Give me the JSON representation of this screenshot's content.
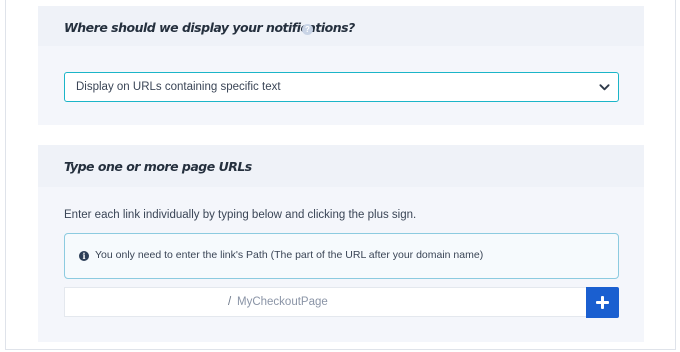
{
  "display_section": {
    "question": "Where should we display your notifications?",
    "help_icon": "?",
    "select": {
      "value": "Display on URLs containing specific text"
    }
  },
  "urls_section": {
    "title": "Type one or more page URLs",
    "instructions": "Enter each link individually by typing below and clicking the plus sign.",
    "info": {
      "icon": "i",
      "text": "You only need to enter the link's Path (The part of the URL after your domain name)"
    },
    "url_input": {
      "prefix": "/",
      "placeholder": "MyCheckoutPage"
    }
  },
  "colors": {
    "accent": "#1a5fd0",
    "select_border": "#1bb5c8",
    "info_border": "#8ccbe0",
    "panel_bg": "#f4f6fb"
  },
  "icons": {
    "help": "question-circle-icon",
    "dropdown": "chevron-down-icon",
    "info": "info-circle-icon",
    "add": "plus-icon"
  }
}
